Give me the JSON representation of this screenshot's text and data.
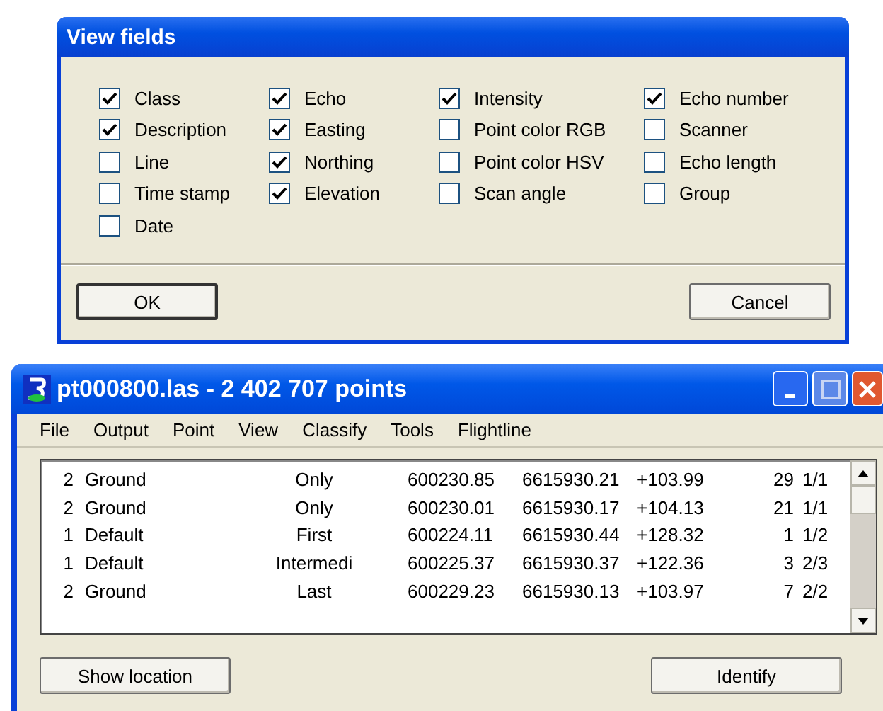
{
  "dialog": {
    "title": "View fields",
    "fields": [
      {
        "label": "Class",
        "checked": true
      },
      {
        "label": "Description",
        "checked": true
      },
      {
        "label": "Line",
        "checked": false
      },
      {
        "label": "Time stamp",
        "checked": false
      },
      {
        "label": "Date",
        "checked": false
      },
      {
        "label": "Echo",
        "checked": true
      },
      {
        "label": "Easting",
        "checked": true
      },
      {
        "label": "Northing",
        "checked": true
      },
      {
        "label": "Elevation",
        "checked": true
      },
      {
        "label": "Intensity",
        "checked": true
      },
      {
        "label": "Point color RGB",
        "checked": false
      },
      {
        "label": "Point color HSV",
        "checked": false
      },
      {
        "label": "Scan angle",
        "checked": false
      },
      {
        "label": "Echo number",
        "checked": true
      },
      {
        "label": "Scanner",
        "checked": false
      },
      {
        "label": "Echo length",
        "checked": false
      },
      {
        "label": "Group",
        "checked": false
      }
    ],
    "buttons": [
      "OK",
      "Cancel"
    ]
  },
  "window": {
    "title": "pt000800.las - 2 402 707 points",
    "menu": [
      "File",
      "Output",
      "Point",
      "View",
      "Classify",
      "Tools",
      "Flightline"
    ],
    "rows": [
      [
        "2",
        "Ground",
        "Only",
        "600230.85",
        "6615930.21",
        "+103.99",
        "29",
        "1/1"
      ],
      [
        "2",
        "Ground",
        "Only",
        "600230.01",
        "6615930.17",
        "+104.13",
        "21",
        "1/1"
      ],
      [
        "1",
        "Default",
        "First",
        "600224.11",
        "6615930.44",
        "+128.32",
        "1",
        "1/2"
      ],
      [
        "1",
        "Default",
        "Intermedi",
        "600225.37",
        "6615930.37",
        "+122.36",
        "3",
        "2/3"
      ],
      [
        "2",
        "Ground",
        "Last",
        "600229.23",
        "6615930.13",
        "+103.97",
        "7",
        "2/2"
      ]
    ],
    "buttons": [
      "Show location",
      "Identify"
    ]
  }
}
